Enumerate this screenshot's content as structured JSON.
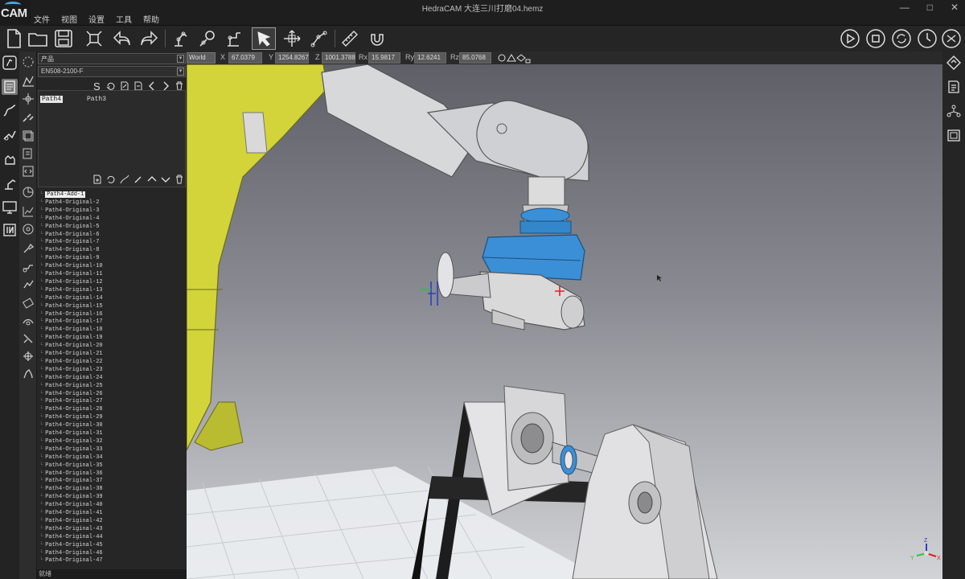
{
  "app": {
    "logo_text": "CAM",
    "title": "HedraCAM   大连三川打磨04.hemz",
    "window_controls": [
      "—",
      "□",
      "✕"
    ]
  },
  "menu": [
    "文件",
    "视图",
    "设置",
    "工具",
    "帮助"
  ],
  "toolbar": {
    "left_icons": [
      "new-file-icon",
      "open-folder-icon",
      "save-icon",
      "fit-view-icon",
      "undo-icon",
      "redo-icon",
      "robot-tool-icon",
      "robot-config-icon",
      "robot-frame-icon",
      "select-arrow-icon",
      "move-gizmo-icon",
      "path-node-icon",
      "measure-ruler-icon",
      "magnet-snap-icon"
    ],
    "right_icons": [
      "play-icon",
      "stop-icon",
      "cycle-icon",
      "timer-icon",
      "settings-circle-icon"
    ]
  },
  "coords": {
    "frame": "World",
    "x_label": "X",
    "x": "67.0379",
    "y_label": "Y",
    "y": "1254.8267",
    "z_label": "Z",
    "z": "1001.3788",
    "rx_label": "Rx",
    "rx": "15.9817",
    "ry_label": "Ry",
    "ry": "12.6241",
    "rz_label": "Rz",
    "rz": "85.0768"
  },
  "panel": {
    "product_select": "产品",
    "model_select": "EN508-2100-F",
    "paths": [
      "Path4",
      "Path3"
    ],
    "path_tools": [
      "S",
      "↻",
      "✎",
      "✎",
      "‹",
      "›",
      "🗑"
    ],
    "points": [
      "Path4-Add-1",
      "Path4-Original-2",
      "Path4-Original-3",
      "Path4-Original-4",
      "Path4-Original-5",
      "Path4-Original-6",
      "Path4-Original-7",
      "Path4-Original-8",
      "Path4-Original-9",
      "Path4-Original-10",
      "Path4-Original-11",
      "Path4-Original-12",
      "Path4-Original-13",
      "Path4-Original-14",
      "Path4-Original-15",
      "Path4-Original-16",
      "Path4-Original-17",
      "Path4-Original-18",
      "Path4-Original-19",
      "Path4-Original-20",
      "Path4-Original-21",
      "Path4-Original-22",
      "Path4-Original-23",
      "Path4-Original-24",
      "Path4-Original-25",
      "Path4-Original-26",
      "Path4-Original-27",
      "Path4-Original-28",
      "Path4-Original-29",
      "Path4-Original-30",
      "Path4-Original-31",
      "Path4-Original-32",
      "Path4-Original-33",
      "Path4-Original-34",
      "Path4-Original-35",
      "Path4-Original-36",
      "Path4-Original-37",
      "Path4-Original-38",
      "Path4-Original-39",
      "Path4-Original-40",
      "Path4-Original-41",
      "Path4-Original-42",
      "Path4-Original-43",
      "Path4-Original-44",
      "Path4-Original-45",
      "Path4-Original-46",
      "Path4-Original-47"
    ],
    "status": "就绪"
  },
  "axis_gizmo": {
    "x": "X",
    "y": "Y",
    "z": "Z"
  },
  "colors": {
    "robot_yellow": "#d8d83a",
    "spindle_blue": "#3b8fd6",
    "accent": "#4aa3df"
  }
}
